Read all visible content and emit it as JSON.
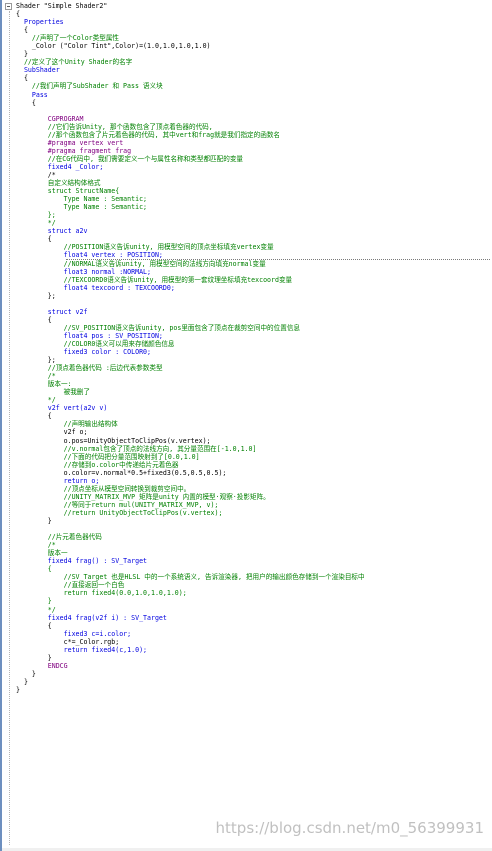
{
  "editor": {
    "lines": [
      {
        "indent": 0,
        "cls": "str",
        "text": "Shader \"Simple Shader2\""
      },
      {
        "indent": 0,
        "cls": "str",
        "text": "{"
      },
      {
        "indent": 2,
        "cls": "kw",
        "text": "Properties"
      },
      {
        "indent": 2,
        "cls": "str",
        "text": "{"
      },
      {
        "indent": 4,
        "cls": "cm",
        "text": "//声明了一个Color类型属性"
      },
      {
        "indent": 4,
        "cls": "str",
        "text": "_Color (\"Color Tint\",Color)=(1.0,1.0,1.0,1.0)"
      },
      {
        "indent": 2,
        "cls": "str",
        "text": "}"
      },
      {
        "indent": 2,
        "cls": "cm",
        "text": "//定义了这个Unity Shader的名字"
      },
      {
        "indent": 2,
        "cls": "kw",
        "text": "SubShader"
      },
      {
        "indent": 2,
        "cls": "str",
        "text": "{"
      },
      {
        "indent": 4,
        "cls": "cm",
        "text": "//我们声明了SubShader 和 Pass 语义块"
      },
      {
        "indent": 4,
        "cls": "kw",
        "text": "Pass"
      },
      {
        "indent": 4,
        "cls": "str",
        "text": "{"
      },
      {
        "indent": 0,
        "cls": "str",
        "text": ""
      },
      {
        "indent": 8,
        "cls": "pp",
        "text": "CGPROGRAM"
      },
      {
        "indent": 8,
        "cls": "cm",
        "text": "//它们告诉Unity, 那个函数包含了顶点着色器的代码,"
      },
      {
        "indent": 8,
        "cls": "cm",
        "text": "//那个函数包含了片元着色器的代码, 其中vert和frag就是我们指定的函数名"
      },
      {
        "indent": 8,
        "cls": "pp",
        "text": "#pragma vertex vert"
      },
      {
        "indent": 8,
        "cls": "pp",
        "text": "#pragma fragment frag"
      },
      {
        "indent": 8,
        "cls": "cm",
        "text": "//在CG代码中, 我们需要定义一个与属性名称和类型都匹配的变量"
      },
      {
        "indent": 8,
        "cls": "kw",
        "text": "fixed4 _Color;"
      },
      {
        "indent": 8,
        "cls": "str",
        "text": "/*"
      },
      {
        "indent": 8,
        "cls": "cm",
        "text": "自定义结构体格式"
      },
      {
        "indent": 8,
        "cls": "cm",
        "text": "struct StructName{"
      },
      {
        "indent": 12,
        "cls": "cm",
        "text": "Type Name : Semantic;"
      },
      {
        "indent": 12,
        "cls": "cm",
        "text": "Type Name : Semantic;"
      },
      {
        "indent": 8,
        "cls": "cm",
        "text": "};"
      },
      {
        "indent": 8,
        "cls": "cm",
        "text": "*/"
      },
      {
        "indent": 8,
        "cls": "kw",
        "text": "struct a2v"
      },
      {
        "indent": 8,
        "cls": "str",
        "text": "{"
      },
      {
        "indent": 12,
        "cls": "cm",
        "text": "//POSITION语义告诉unity, 用模型空间的顶点坐标填充vertex变量"
      },
      {
        "indent": 12,
        "cls": "kw",
        "text": "float4 vertex : POSITION;"
      },
      {
        "indent": 12,
        "cls": "cm",
        "text": "//NORMAL语义告诉unity, 用模型空间的法线方向填充normal变量"
      },
      {
        "indent": 12,
        "cls": "kw",
        "text": "float3 normal :NORMAL;"
      },
      {
        "indent": 12,
        "cls": "cm",
        "text": "//TEXCOORD0语义告诉unity, 用模型的第一套纹理坐标填充texcoord变量"
      },
      {
        "indent": 12,
        "cls": "kw",
        "text": "float4 texcoord : TEXCOORD0;"
      },
      {
        "indent": 8,
        "cls": "str",
        "text": "};"
      },
      {
        "indent": 0,
        "cls": "str",
        "text": ""
      },
      {
        "indent": 8,
        "cls": "kw",
        "text": "struct v2f"
      },
      {
        "indent": 8,
        "cls": "str",
        "text": "{"
      },
      {
        "indent": 12,
        "cls": "cm",
        "text": "//SV_POSITION语义告诉unity, pos里面包含了顶点在裁剪空间中的位置信息"
      },
      {
        "indent": 12,
        "cls": "kw",
        "text": "float4 pos : SV_POSITION;"
      },
      {
        "indent": 12,
        "cls": "cm",
        "text": "//COLOR0语义可以用来存储颜色信息"
      },
      {
        "indent": 12,
        "cls": "kw",
        "text": "fixed3 color : COLOR0;"
      },
      {
        "indent": 8,
        "cls": "str",
        "text": "};"
      },
      {
        "indent": 8,
        "cls": "cm",
        "text": "//顶点着色器代码 :后边代表参数类型"
      },
      {
        "indent": 8,
        "cls": "cm",
        "text": "/*"
      },
      {
        "indent": 8,
        "cls": "cm",
        "text": "版本一:"
      },
      {
        "indent": 12,
        "cls": "cm",
        "text": "被我删了"
      },
      {
        "indent": 8,
        "cls": "cm",
        "text": "*/"
      },
      {
        "indent": 8,
        "cls": "kw",
        "text": "v2f vert(a2v v)"
      },
      {
        "indent": 8,
        "cls": "str",
        "text": "{"
      },
      {
        "indent": 12,
        "cls": "cm",
        "text": "//声明输出结构体"
      },
      {
        "indent": 12,
        "cls": "str",
        "text": "v2f o;"
      },
      {
        "indent": 12,
        "cls": "str",
        "text": "o.pos=UnityObjectToClipPos(v.vertex);"
      },
      {
        "indent": 12,
        "cls": "cm",
        "text": "//v.normal包含了顶点的法线方向, 其分量范围在[-1.0,1.0]"
      },
      {
        "indent": 12,
        "cls": "cm",
        "text": "//下面的代码把分量范围映射到了[0.0,1.0]"
      },
      {
        "indent": 12,
        "cls": "cm",
        "text": "//存储到o.color中传递给片元着色器"
      },
      {
        "indent": 12,
        "cls": "str",
        "text": "o.color=v.normal*0.5+fixed3(0.5,0.5,0.5);"
      },
      {
        "indent": 12,
        "cls": "kw",
        "text": "return o;"
      },
      {
        "indent": 12,
        "cls": "cm",
        "text": "//顶点坐标从模型空间转换到裁剪空间中。"
      },
      {
        "indent": 12,
        "cls": "cm",
        "text": "//UNITY_MATRIX_MVP 矩阵是unity 内置的模型·观察·投影矩阵。"
      },
      {
        "indent": 12,
        "cls": "cm",
        "text": "//等同于return mul(UNITY_MATRIX_MVP, v);"
      },
      {
        "indent": 12,
        "cls": "cm",
        "text": "//return UnityObjectToClipPos(v.vertex);"
      },
      {
        "indent": 8,
        "cls": "str",
        "text": "}"
      },
      {
        "indent": 0,
        "cls": "str",
        "text": ""
      },
      {
        "indent": 8,
        "cls": "cm",
        "text": "//片元着色器代码"
      },
      {
        "indent": 8,
        "cls": "cm",
        "text": "/*"
      },
      {
        "indent": 8,
        "cls": "cm",
        "text": "版本一"
      },
      {
        "indent": 8,
        "cls": "kw",
        "text": "fixed4 frag() : SV_Target"
      },
      {
        "indent": 8,
        "cls": "cm",
        "text": "{"
      },
      {
        "indent": 12,
        "cls": "cm",
        "text": "//SV_Target 也是HLSL 中的一个系统语义, 告诉渲染器, 把用户的输出颜色存储到一个渲染目标中"
      },
      {
        "indent": 12,
        "cls": "cm",
        "text": "//直接返回一个白色"
      },
      {
        "indent": 12,
        "cls": "cm",
        "text": "return fixed4(0.0,1.0,1.0,1.0);"
      },
      {
        "indent": 8,
        "cls": "cm",
        "text": "}"
      },
      {
        "indent": 8,
        "cls": "cm",
        "text": "*/"
      },
      {
        "indent": 8,
        "cls": "kw",
        "text": "fixed4 frag(v2f i) : SV_Target"
      },
      {
        "indent": 8,
        "cls": "str",
        "text": "{"
      },
      {
        "indent": 12,
        "cls": "kw",
        "text": "fixed3 c=i.color;"
      },
      {
        "indent": 12,
        "cls": "str",
        "text": "c*=_Color.rgb;"
      },
      {
        "indent": 12,
        "cls": "kw",
        "text": "return fixed4(c,1.0);"
      },
      {
        "indent": 8,
        "cls": "str",
        "text": "}"
      },
      {
        "indent": 8,
        "cls": "pp",
        "text": "ENDCG"
      },
      {
        "indent": 4,
        "cls": "str",
        "text": "}"
      },
      {
        "indent": 2,
        "cls": "str",
        "text": "}"
      },
      {
        "indent": 0,
        "cls": "str",
        "text": "}"
      }
    ]
  },
  "watermark": "https://blog.csdn.net/m0_56399931",
  "colors": {
    "keyword": "#0000e0",
    "comment": "#008000",
    "preprocessor": "#800080",
    "text": "#000000"
  }
}
